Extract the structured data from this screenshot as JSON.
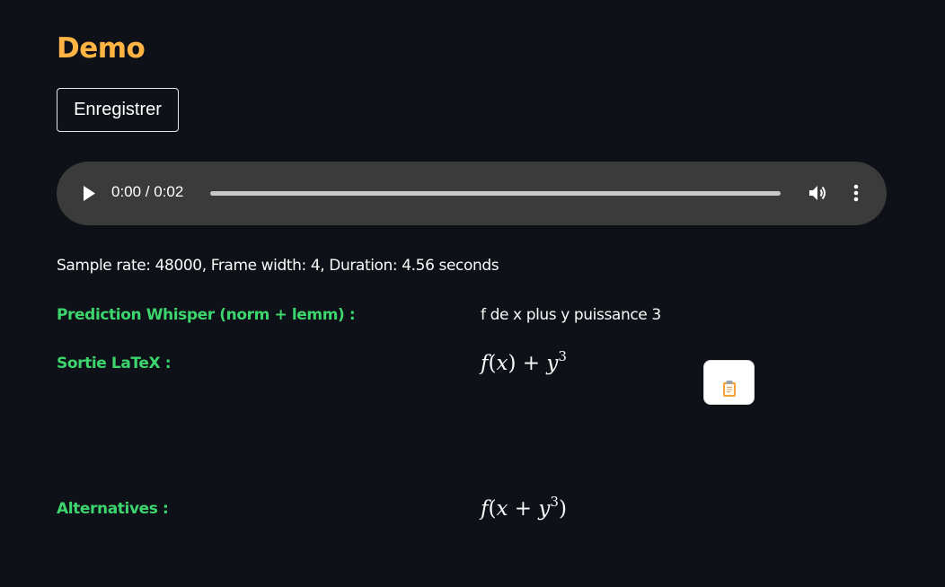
{
  "page": {
    "title": "Demo"
  },
  "record_button": {
    "label": "Enregistrer"
  },
  "audio_player": {
    "time": "0:00 / 0:02",
    "progress": 0,
    "icons": {
      "play": "play-icon",
      "volume": "volume-icon",
      "more": "more-options-icon"
    }
  },
  "sample_info": "Sample rate: 48000, Frame width: 4, Duration: 4.56 seconds",
  "prediction": {
    "label": "Prediction Whisper (norm + lemm) :",
    "value": "f de x plus y puissance 3"
  },
  "latex_output": {
    "label": "Sortie LaTeX :",
    "formula": "f(x)+y^3",
    "copy_icon": "clipboard-icon"
  },
  "alternatives": {
    "label": "Alternatives :",
    "formulas": [
      "f(x+y^3)"
    ]
  },
  "colors": {
    "background": "#0e1117",
    "title": "#ffb443",
    "label": "#3dd56d",
    "text": "#fafafa",
    "player": "#3b3b3b"
  }
}
